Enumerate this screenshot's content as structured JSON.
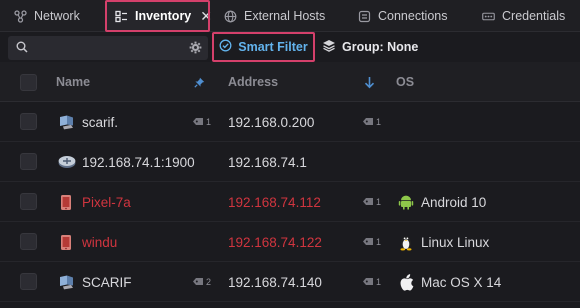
{
  "tabs": [
    {
      "label": "Network",
      "icon": "network-icon"
    },
    {
      "label": "Inventory",
      "icon": "inventory-icon",
      "active": true
    },
    {
      "label": "External Hosts",
      "icon": "globe-icon"
    },
    {
      "label": "Connections",
      "icon": "connections-icon"
    },
    {
      "label": "Credentials",
      "icon": "credentials-icon"
    }
  ],
  "toolbar": {
    "search_placeholder": "",
    "smart_filter_label": "Smart Filter",
    "group_label": "Group: None"
  },
  "table": {
    "columns": {
      "name": "Name",
      "address": "Address",
      "os": "OS"
    },
    "rows": [
      {
        "name": "scarif.",
        "name_tag_count": "1",
        "address": "192.168.0.200",
        "address_tag_count": "1",
        "os": "",
        "status": "normal",
        "icon": "computer-icon"
      },
      {
        "name": "192.168.74.1:1900",
        "name_tag_count": "",
        "address": "192.168.74.1",
        "address_tag_count": "",
        "os": "",
        "status": "normal",
        "icon": "router-icon"
      },
      {
        "name": "Pixel-7a",
        "name_tag_count": "",
        "address": "192.168.74.112",
        "address_tag_count": "1",
        "os": "Android 10",
        "status": "alert",
        "icon": "phone-icon",
        "os_icon": "android-icon"
      },
      {
        "name": "windu",
        "name_tag_count": "",
        "address": "192.168.74.122",
        "address_tag_count": "1",
        "os": "Linux Linux",
        "status": "alert",
        "icon": "phone-icon",
        "os_icon": "linux-icon"
      },
      {
        "name": "SCARIF",
        "name_tag_count": "2",
        "address": "192.168.74.140",
        "address_tag_count": "1",
        "os": "Mac OS X 14",
        "status": "normal",
        "icon": "computer-icon",
        "os_icon": "apple-icon"
      }
    ]
  },
  "colors": {
    "accent": "#63b3ed",
    "alert": "#d0353f",
    "highlight": "#d4406b"
  }
}
